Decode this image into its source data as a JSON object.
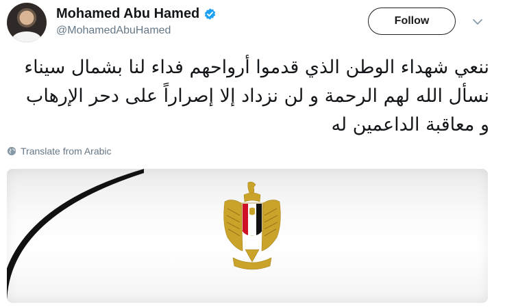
{
  "user": {
    "display_name": "Mohamed Abu Hamed",
    "handle": "@MohamedAbuHamed",
    "verified": true,
    "avatar_icon": "profile-photo"
  },
  "actions": {
    "follow_label": "Follow",
    "more_icon": "chevron-down-icon"
  },
  "tweet": {
    "lines": [
      "ننعي شهداء الوطن الذي قدموا أرواحهم فداء لنا بشمال سيناء",
      "نسأل الله لهم الرحمة و لن نزداد إلا إصراراً على دحر الإرهاب",
      "و معاقبة الداعمين له"
    ],
    "translate_label": "Translate from Arabic"
  },
  "media": {
    "description_icon": "egypt-eagle-emblem",
    "ribbon_color": "#111111"
  },
  "colors": {
    "accent": "#1da1f2",
    "text": "#14171a",
    "secondary": "#657786",
    "emblem_gold": "#c9a32a",
    "flag_red": "#ce1126"
  }
}
